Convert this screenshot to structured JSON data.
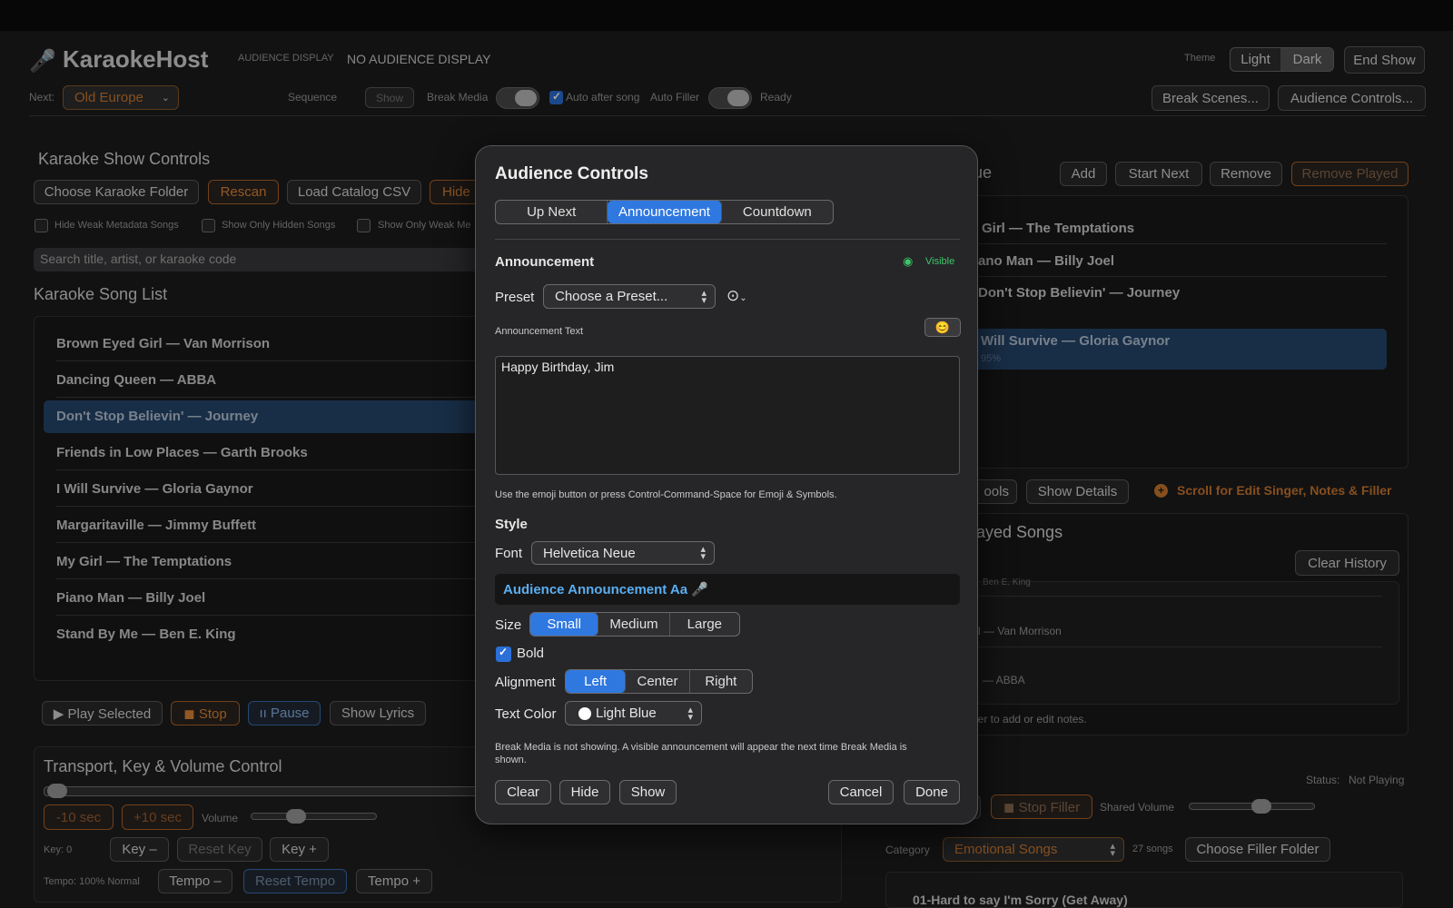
{
  "app": {
    "name": "KaraokeHost",
    "audience_display_label": "AUDIENCE DISPLAY",
    "audience_display_status": "NO AUDIENCE DISPLAY",
    "theme_label": "Theme",
    "theme_options": [
      "Light",
      "Dark"
    ],
    "end_show": "End Show",
    "next_label": "Next:",
    "next_value": "Old Europe",
    "sequence_label": "Sequence",
    "sequence_show": "Show",
    "break_media_label": "Break Media",
    "auto_after_song": "Auto after song",
    "auto_filler_label": "Auto Filler",
    "ready": "Ready",
    "break_scenes": "Break Scenes...",
    "audience_controls": "Audience Controls..."
  },
  "left": {
    "controls_title": "Karaoke Show Controls",
    "choose_folder": "Choose Karaoke Folder",
    "rescan": "Rescan",
    "load_catalog": "Load Catalog CSV",
    "hide_btn": "Hide",
    "filters": [
      "Hide Weak Metadata Songs",
      "Show Only Hidden Songs",
      "Show Only Weak Me"
    ],
    "search_placeholder": "Search title, artist, or karaoke code",
    "song_list_title": "Karaoke Song List",
    "songs": [
      "Brown Eyed Girl — Van Morrison",
      "Dancing Queen — ABBA",
      "Don't Stop Believin' — Journey",
      "Friends in Low Places — Garth Brooks",
      "I Will Survive — Gloria Gaynor",
      "Margaritaville — Jimmy Buffett",
      "My Girl — The Temptations",
      "Piano Man — Billy Joel",
      "Stand By Me — Ben E. King"
    ],
    "play_selected": "▶ Play Selected",
    "stop": "◼ Stop",
    "pause": "ıı Pause",
    "show_lyrics": "Show Lyrics",
    "transport_title": "Transport, Key & Volume Control",
    "minus10": "-10 sec",
    "plus10": "+10 sec",
    "volume": "Volume",
    "key_label": "Key: 0",
    "key_minus": "Key –",
    "reset_key": "Reset Key",
    "key_plus": "Key +",
    "tempo_label": "Tempo: 100% Normal",
    "tempo_minus": "Tempo –",
    "reset_tempo": "Reset Tempo",
    "tempo_plus": "Tempo +"
  },
  "right": {
    "queue_title_partial": "ue",
    "add": "Add",
    "start_next": "Start Next",
    "remove": "Remove",
    "remove_played": "Remove Played",
    "queue": [
      "Girl — The Temptations",
      "ano Man — Billy Joel",
      "Don't Stop Believin' — Journey",
      "Will Survive — Gloria Gaynor"
    ],
    "queue_progress": "95%",
    "tools_partial": "ools",
    "show_details": "Show Details",
    "scroll_hint": "Scroll for Edit Singer, Notes & Filler",
    "played_title_partial": "ayed Songs",
    "clear_history": "Clear History",
    "played": [
      "Ben E. King",
      "l — Van Morrison",
      "— ABBA"
    ],
    "notes_hint": "ger to add or edit notes.",
    "status_label": "Status:",
    "status_value": "Not Playing",
    "stop_filler": "◼ Stop Filler",
    "shared_volume": "Shared Volume",
    "category_label": "Category",
    "category_value": "Emotional Songs",
    "song_count": "27 songs",
    "choose_filler_folder": "Choose Filler Folder",
    "filler_item": "01-Hard to say I'm Sorry (Get Away)"
  },
  "modal": {
    "title": "Audience Controls",
    "tabs": [
      "Up Next",
      "Announcement",
      "Countdown"
    ],
    "section": "Announcement",
    "visible": "Visible",
    "preset_label": "Preset",
    "preset_value": "Choose a Preset...",
    "text_label": "Announcement Text",
    "emoji": "😊",
    "text_value": "Happy Birthday, Jim",
    "emoji_hint": "Use the emoji button or press Control-Command-Space for Emoji & Symbols.",
    "style_title": "Style",
    "font_label": "Font",
    "font_value": "Helvetica Neue",
    "preview": "Audience Announcement Aa 🎤",
    "size_label": "Size",
    "sizes": [
      "Small",
      "Medium",
      "Large"
    ],
    "bold_label": "Bold",
    "alignment_label": "Alignment",
    "alignments": [
      "Left",
      "Center",
      "Right"
    ],
    "color_label": "Text Color",
    "color_value": "Light Blue",
    "notice": "Break Media is not showing. A visible announcement will appear the next time Break Media is shown.",
    "clear": "Clear",
    "hide": "Hide",
    "show": "Show",
    "cancel": "Cancel",
    "done": "Done"
  },
  "colors": {
    "accent": "#2f78e0",
    "orange": "#e0873a",
    "green": "#3fc46a",
    "preview_blue": "#5aaef0"
  }
}
